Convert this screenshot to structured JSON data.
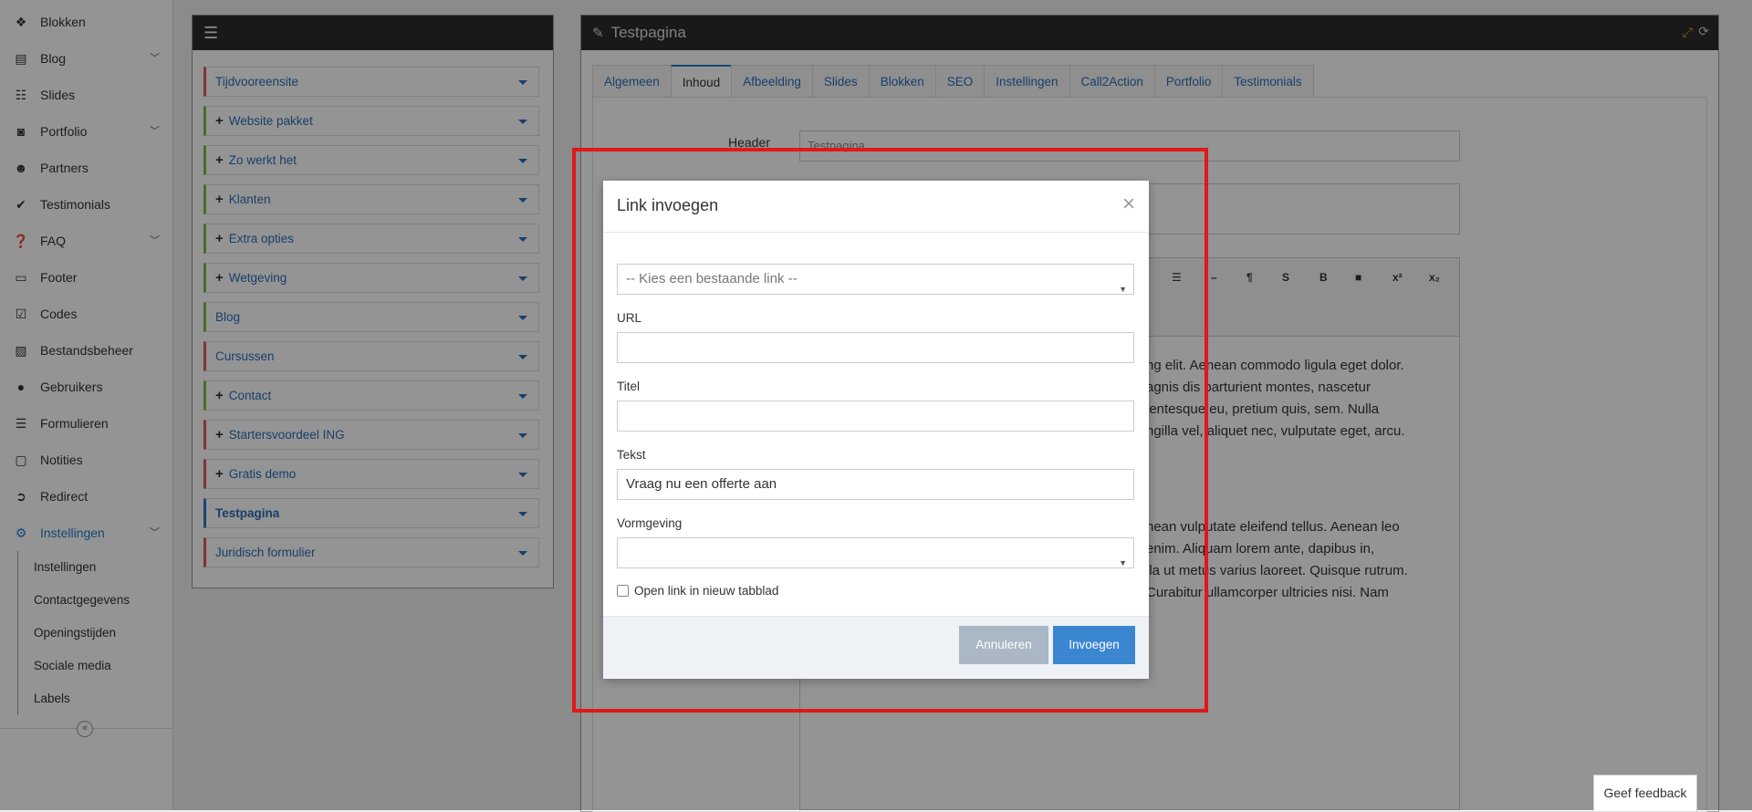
{
  "sidebar": {
    "items": [
      {
        "label": "Blokken",
        "icon": "cubes-icon"
      },
      {
        "label": "Blog",
        "icon": "file-icon",
        "chevron": true
      },
      {
        "label": "Slides",
        "icon": "sliders-icon"
      },
      {
        "label": "Portfolio",
        "icon": "camera-icon",
        "chevron": true
      },
      {
        "label": "Partners",
        "icon": "users-icon"
      },
      {
        "label": "Testimonials",
        "icon": "check-icon"
      },
      {
        "label": "FAQ",
        "icon": "question-icon",
        "chevron": true
      },
      {
        "label": "Footer",
        "icon": "window-icon"
      },
      {
        "label": "Codes",
        "icon": "checkbox-icon"
      },
      {
        "label": "Bestandsbeheer",
        "icon": "image-icon"
      },
      {
        "label": "Gebruikers",
        "icon": "user-icon"
      },
      {
        "label": "Formulieren",
        "icon": "form-icon"
      },
      {
        "label": "Notities",
        "icon": "note-icon"
      },
      {
        "label": "Redirect",
        "icon": "arrow-circle-icon"
      },
      {
        "label": "Instellingen",
        "icon": "gear-icon",
        "chevron": true,
        "active": true
      }
    ],
    "subitems": [
      "Instellingen",
      "Contactgegevens",
      "Openingstijden",
      "Sociale media",
      "Labels"
    ],
    "collapse_glyph": "«"
  },
  "menu_panel": {
    "items": [
      {
        "label": "Tijdvooreensite",
        "plus": false,
        "border": "red"
      },
      {
        "label": "Website pakket",
        "plus": true,
        "border": "green"
      },
      {
        "label": "Zo werkt het",
        "plus": true,
        "border": "green"
      },
      {
        "label": "Klanten",
        "plus": true,
        "border": "green"
      },
      {
        "label": "Extra opties",
        "plus": true,
        "border": "green"
      },
      {
        "label": "Wetgeving",
        "plus": true,
        "border": "green"
      },
      {
        "label": "Blog",
        "plus": false,
        "border": "green"
      },
      {
        "label": "Cursussen",
        "plus": false,
        "border": "red"
      },
      {
        "label": "Contact",
        "plus": true,
        "border": "green"
      },
      {
        "label": "Startersvoordeel ING",
        "plus": true,
        "border": "red"
      },
      {
        "label": "Gratis demo",
        "plus": true,
        "border": "red"
      },
      {
        "label": "Testpagina",
        "plus": false,
        "border": "blue"
      },
      {
        "label": "Juridisch formulier",
        "plus": false,
        "border": "red"
      }
    ]
  },
  "editor": {
    "title": "Testpagina",
    "tabs": [
      "Algemeen",
      "Inhoud",
      "Afbeelding",
      "Slides",
      "Blokken",
      "SEO",
      "Instellingen",
      "Call2Action",
      "Portfolio",
      "Testimonials"
    ],
    "active_tab": "Inhoud",
    "header_label": "Header",
    "header_value": "Testpagina",
    "toolbar": [
      "☰",
      "–",
      "¶",
      "S",
      "B",
      "■",
      "x²",
      "x₂"
    ],
    "paragraph1": [
      "ng elit. Aenean commodo ligula eget dolor.",
      "agnis dis parturient montes, nascetur",
      "lentesque eu, pretium quis, sem. Nulla",
      "ngilla vel, aliquet nec, vulputate eget, arcu."
    ],
    "paragraph2": [
      "nean vulputate eleifend tellus. Aenean leo",
      "enim. Aliquam lorem ante, dapibus in,",
      "lla ut metus varius laoreet. Quisque rutrum.",
      "Curabitur ullamcorper ultricies nisi. Nam"
    ]
  },
  "modal": {
    "title": "Link invoegen",
    "close_glyph": "×",
    "existing_link_placeholder": "-- Kies een bestaande link --",
    "url_label": "URL",
    "url_value": "",
    "title_label": "Titel",
    "title_value": "",
    "text_label": "Tekst",
    "text_value": "Vraag nu een offerte aan",
    "style_label": "Vormgeving",
    "style_value": "",
    "newtab_label": "Open link in nieuw tabblad",
    "cancel_label": "Annuleren",
    "insert_label": "Invoegen"
  },
  "feedback_label": "Geef feedback",
  "colors": {
    "accent": "#3b86d1",
    "highlight": "#e01818",
    "panel_header": "#2b2b2b"
  }
}
